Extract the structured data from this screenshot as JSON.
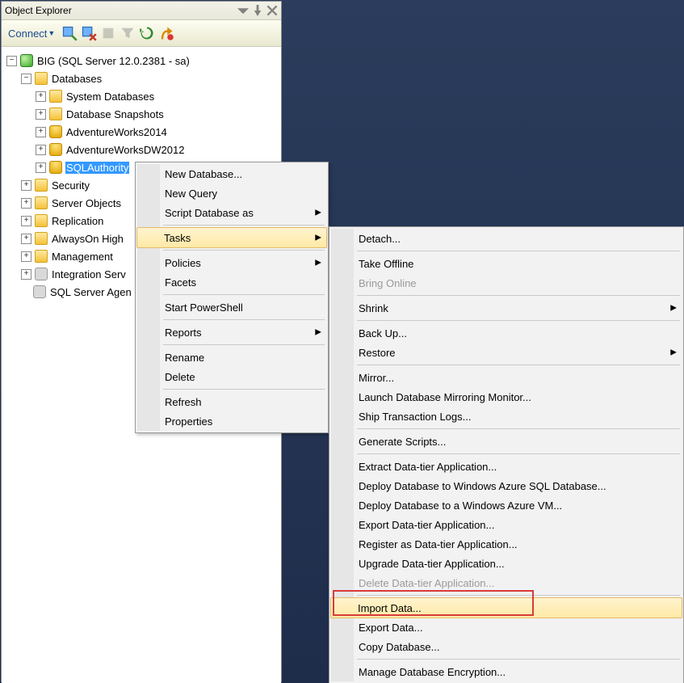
{
  "panel": {
    "title": "Object Explorer",
    "connect_label": "Connect"
  },
  "tree": {
    "server": "BIG (SQL Server 12.0.2381 - sa)",
    "databases_label": "Databases",
    "system_db_label": "System Databases",
    "snapshots_label": "Database Snapshots",
    "db1": "AdventureWorks2014",
    "db2": "AdventureWorksDW2012",
    "db3": "SQLAuthority",
    "security": "Security",
    "server_objects": "Server Objects",
    "replication": "Replication",
    "alwayson": "AlwaysOn High",
    "management": "Management",
    "integration": "Integration Serv",
    "agent": "SQL Server Agen"
  },
  "ctx1": {
    "new_db": "New Database...",
    "new_query": "New Query",
    "script_db": "Script Database as",
    "tasks": "Tasks",
    "policies": "Policies",
    "facets": "Facets",
    "powershell": "Start PowerShell",
    "reports": "Reports",
    "rename": "Rename",
    "delete": "Delete",
    "refresh": "Refresh",
    "properties": "Properties"
  },
  "ctx2": {
    "detach": "Detach...",
    "take_offline": "Take Offline",
    "bring_online": "Bring Online",
    "shrink": "Shrink",
    "backup": "Back Up...",
    "restore": "Restore",
    "mirror": "Mirror...",
    "launch_mirror": "Launch Database Mirroring Monitor...",
    "ship_logs": "Ship Transaction Logs...",
    "gen_scripts": "Generate Scripts...",
    "extract_dt": "Extract Data-tier Application...",
    "deploy_azure_db": "Deploy Database to Windows Azure SQL Database...",
    "deploy_azure_vm": "Deploy Database to a Windows Azure VM...",
    "export_dt": "Export Data-tier Application...",
    "register_dt": "Register as Data-tier Application...",
    "upgrade_dt": "Upgrade Data-tier Application...",
    "delete_dt": "Delete Data-tier Application...",
    "import_data": "Import Data...",
    "export_data": "Export Data...",
    "copy_db": "Copy Database...",
    "manage_enc": "Manage Database Encryption..."
  }
}
